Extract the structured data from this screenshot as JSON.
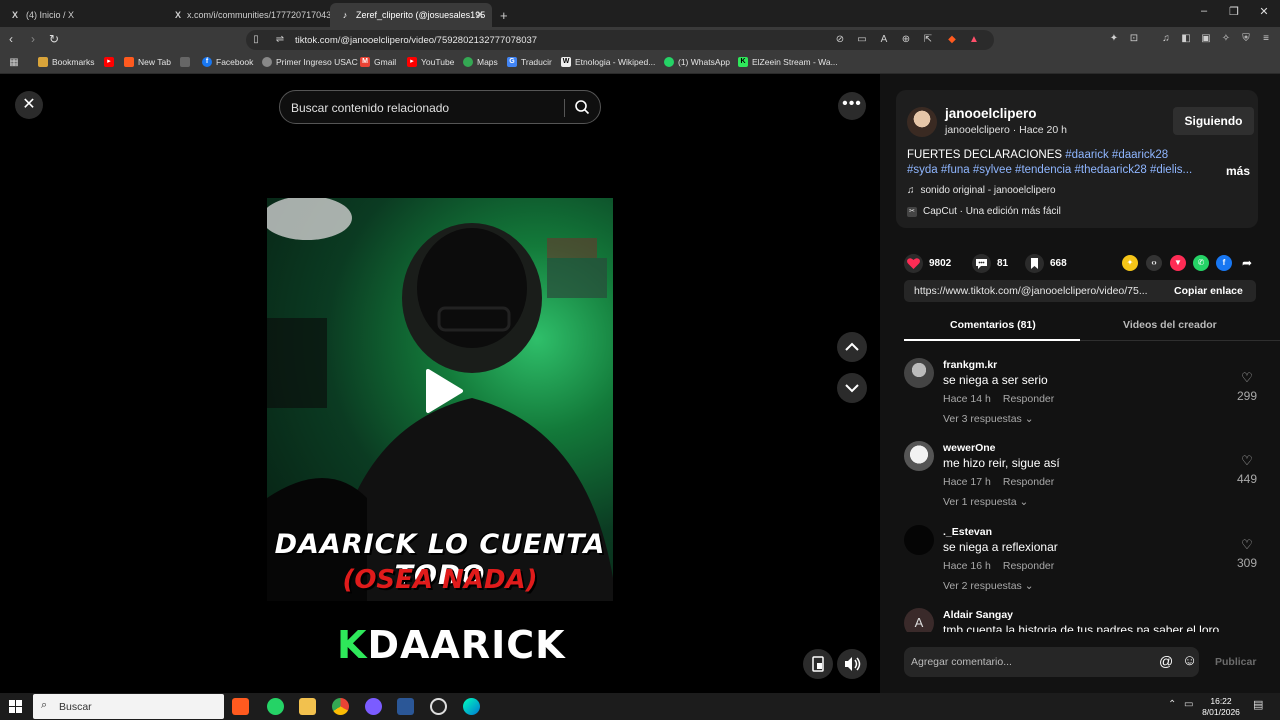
{
  "browser": {
    "tabs": [
      {
        "label": "(4) Inicio / X",
        "favicon": "X"
      },
      {
        "label": "x.com/i/communities/177720717043",
        "favicon": "X"
      },
      {
        "label": "Zeref_cliperito (@josuesales195",
        "favicon": "♪"
      }
    ],
    "new_tab": "+",
    "url": "tiktok.com/@janooelclipero/video/7592802132777078037",
    "bookmarks": [
      {
        "label": "Bookmarks"
      },
      {
        "label": "New Tab"
      },
      {
        "label": "Facebook"
      },
      {
        "label": "Primer Ingreso USAC"
      },
      {
        "label": "Gmail"
      },
      {
        "label": "YouTube"
      },
      {
        "label": "Maps"
      },
      {
        "label": "Traducir"
      },
      {
        "label": "Etnologia - Wikiped..."
      },
      {
        "label": "(1) WhatsApp"
      },
      {
        "label": "ElZeein Stream - Wa..."
      }
    ]
  },
  "player": {
    "search_placeholder": "Buscar contenido relacionado",
    "overlay_line1": "DAARICK LO CUENTA TODO",
    "overlay_line2": "(OSEA NADA)",
    "brand_k": "K",
    "brand_rest": "DAARICK"
  },
  "post": {
    "username": "janooelclipero",
    "subline": "janooelclipero · Hace 20 h",
    "follow_label": "Siguiendo",
    "desc_text": "FUERTES DECLARACIONES ",
    "desc_tags": "#daarick #daarick28 #syda #funa #sylvee #tendencia #thedaarick28 #dielis...",
    "more_label": "más",
    "sound": "sonido original - janooelclipero",
    "capcut": "CapCut · Una edición más fácil",
    "likes": "9802",
    "comments": "81",
    "saves": "668",
    "link": "https://www.tiktok.com/@janooelclipero/video/75...",
    "copy_label": "Copiar enlace",
    "tab_comments": "Comentarios (81)",
    "tab_creator": "Videos del creador",
    "comment_placeholder": "Agregar comentario...",
    "publish_label": "Publicar"
  },
  "comments": [
    {
      "user": "frankgm.kr",
      "text": "se niega a ser serio",
      "time": "Hace 14 h",
      "reply": "Responder",
      "replies": "Ver 3 respuestas",
      "likes": "299"
    },
    {
      "user": "wewerOne",
      "text": "me hizo reir, sigue así",
      "time": "Hace 17 h",
      "reply": "Responder",
      "replies": "Ver 1 respuesta",
      "likes": "449"
    },
    {
      "user": "._Estevan",
      "text": "se niega a reflexionar",
      "time": "Hace 16 h",
      "reply": "Responder",
      "replies": "Ver 2 respuestas",
      "likes": "309"
    },
    {
      "user": "Aldair Sangay",
      "text": "tmb cuenta la historia de tus padres pa saber el loro",
      "avatar_letter": "A"
    }
  ],
  "taskbar": {
    "search_placeholder": "Buscar",
    "time": "16:22",
    "date": "8/01/2026"
  },
  "colors": {
    "like_red": "#fe2c55",
    "hashtag_blue": "#8fb6ff",
    "tab_active": "#3a3a3a"
  }
}
